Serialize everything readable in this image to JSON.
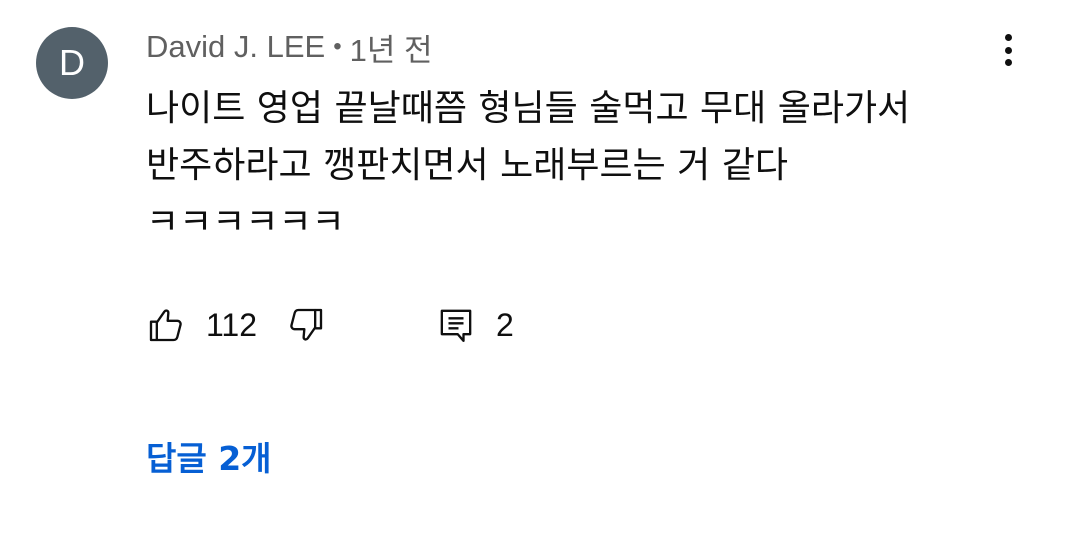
{
  "comment": {
    "avatar_letter": "D",
    "avatar_color": "#53616b",
    "author": "David J. LEE",
    "separator": "•",
    "time": "1년 전",
    "text": "나이트 영업 끝날때쯤 형님들 술먹고 무대 올라가서\n반주하라고 깽판치면서 노래부르는 거 같다\nㅋㅋㅋㅋㅋㅋ",
    "likes": "112",
    "reply_count": "2",
    "replies_label": "답글 2개",
    "accent_color": "#065fd4"
  },
  "icons": {
    "more": "more-vert-icon",
    "like": "thumbs-up-icon",
    "dislike": "thumbs-down-icon",
    "reply": "comment-icon"
  }
}
